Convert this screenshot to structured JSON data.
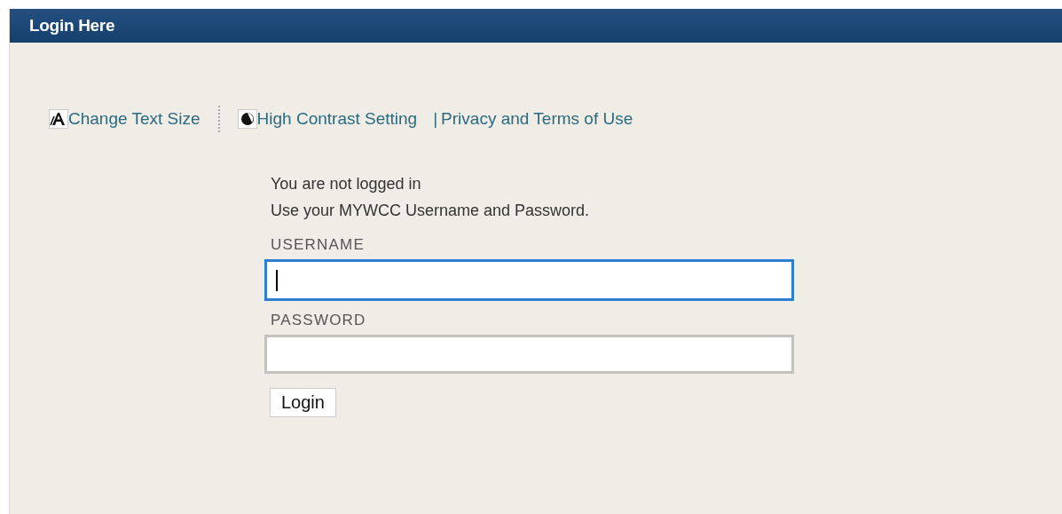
{
  "panel": {
    "title": "Login Here"
  },
  "toolbar": [
    {
      "kind": "text-size",
      "label": "Change Text Size"
    },
    {
      "kind": "contrast",
      "label": "High Contrast Setting"
    },
    {
      "kind": "plain",
      "separator": "|",
      "label": "Privacy and Terms of Use"
    }
  ],
  "messages": [
    "You are not logged in",
    "Use your MYWCC Username and Password."
  ],
  "fields": [
    {
      "label": "USERNAME",
      "focused": true
    },
    {
      "label": "PASSWORD",
      "focused": false
    }
  ],
  "submit": "Login"
}
